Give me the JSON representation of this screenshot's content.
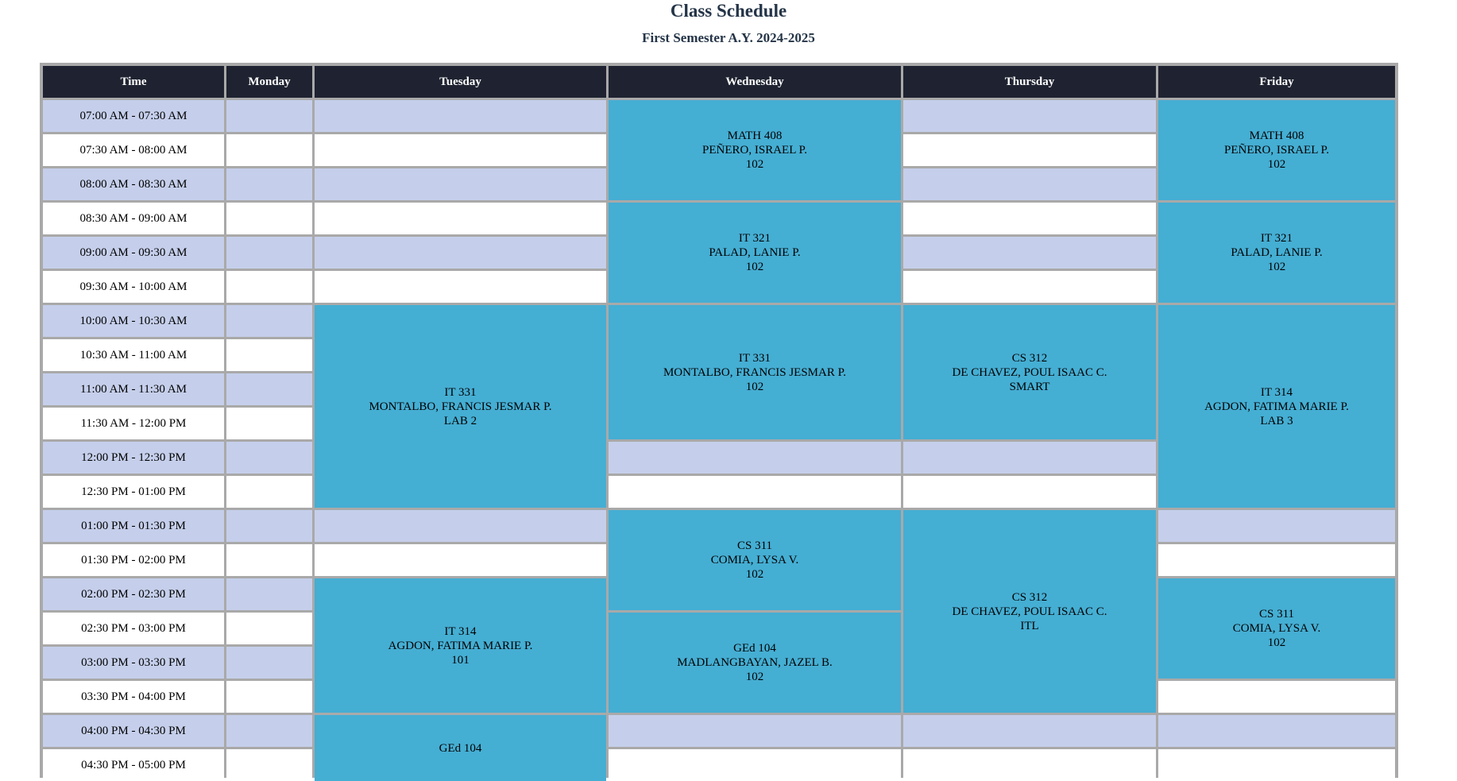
{
  "header": {
    "title": "Class Schedule",
    "subtitle": "First Semester A.Y. 2024-2025"
  },
  "table": {
    "columns": [
      "Time",
      "Monday",
      "Tuesday",
      "Wednesday",
      "Thursday",
      "Friday"
    ],
    "times": [
      "07:00 AM - 07:30 AM",
      "07:30 AM - 08:00 AM",
      "08:00 AM - 08:30 AM",
      "08:30 AM - 09:00 AM",
      "09:00 AM - 09:30 AM",
      "09:30 AM - 10:00 AM",
      "10:00 AM - 10:30 AM",
      "10:30 AM - 11:00 AM",
      "11:00 AM - 11:30 AM",
      "11:30 AM - 12:00 PM",
      "12:00 PM - 12:30 PM",
      "12:30 PM - 01:00 PM",
      "01:00 PM - 01:30 PM",
      "01:30 PM - 02:00 PM",
      "02:00 PM - 02:30 PM",
      "02:30 PM - 03:00 PM",
      "03:00 PM - 03:30 PM",
      "03:30 PM - 04:00 PM",
      "04:00 PM - 04:30 PM",
      "04:30 PM - 05:00 PM"
    ],
    "classes": [
      {
        "day": 2,
        "start": 6,
        "span": 6,
        "code": "IT 331",
        "instructor": "MONTALBO, FRANCIS JESMAR P.",
        "room": "LAB 2"
      },
      {
        "day": 2,
        "start": 14,
        "span": 4,
        "code": "IT 314",
        "instructor": "AGDON, FATIMA MARIE P.",
        "room": "101"
      },
      {
        "day": 2,
        "start": 18,
        "span": 2,
        "code": "GEd 104",
        "instructor": "",
        "room": ""
      },
      {
        "day": 3,
        "start": 0,
        "span": 3,
        "code": "MATH 408",
        "instructor": "PEÑERO, ISRAEL P.",
        "room": "102"
      },
      {
        "day": 3,
        "start": 3,
        "span": 3,
        "code": "IT 321",
        "instructor": "PALAD, LANIE P.",
        "room": "102"
      },
      {
        "day": 3,
        "start": 6,
        "span": 4,
        "code": "IT 331",
        "instructor": "MONTALBO, FRANCIS JESMAR P.",
        "room": "102"
      },
      {
        "day": 3,
        "start": 12,
        "span": 3,
        "code": "CS 311",
        "instructor": "COMIA, LYSA V.",
        "room": "102"
      },
      {
        "day": 3,
        "start": 15,
        "span": 3,
        "code": "GEd 104",
        "instructor": "MADLANGBAYAN, JAZEL B.",
        "room": "102"
      },
      {
        "day": 4,
        "start": 6,
        "span": 4,
        "code": "CS 312",
        "instructor": "DE CHAVEZ, POUL ISAAC C.",
        "room": "SMART"
      },
      {
        "day": 4,
        "start": 12,
        "span": 6,
        "code": "CS 312",
        "instructor": "DE CHAVEZ, POUL ISAAC C.",
        "room": "ITL"
      },
      {
        "day": 5,
        "start": 0,
        "span": 3,
        "code": "MATH 408",
        "instructor": "PEÑERO, ISRAEL P.",
        "room": "102"
      },
      {
        "day": 5,
        "start": 3,
        "span": 3,
        "code": "IT 321",
        "instructor": "PALAD, LANIE P.",
        "room": "102"
      },
      {
        "day": 5,
        "start": 6,
        "span": 6,
        "code": "IT 314",
        "instructor": "AGDON, FATIMA MARIE P.",
        "room": "LAB 3"
      },
      {
        "day": 5,
        "start": 14,
        "span": 3,
        "code": "CS 311",
        "instructor": "COMIA, LYSA V.",
        "room": "102"
      }
    ]
  },
  "colors": {
    "header_bg": "#1f2331",
    "row_alt": "#c5cfeb",
    "row_white": "#ffffff",
    "class_block": "#45aed3",
    "border": "#a9a9a9",
    "title": "#243447"
  }
}
